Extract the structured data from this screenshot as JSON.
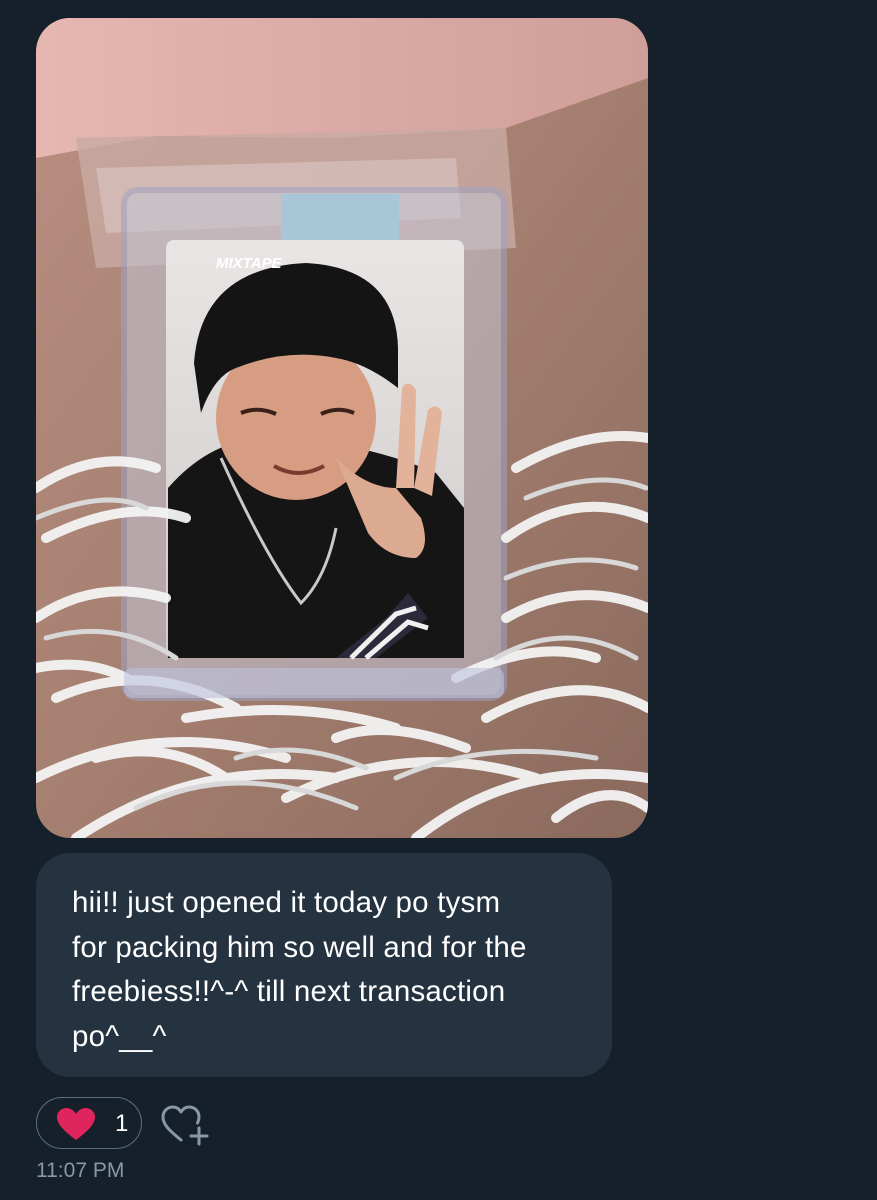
{
  "message": {
    "image_alt": "photo",
    "photo_brand_text": "MIXTAPE",
    "lines": [
      "hii!! just opened it today po tysm",
      "for packing him so well and for the",
      "freebiess!!^-^ till next transaction",
      "po^__^"
    ],
    "timestamp": "11:07 PM"
  },
  "reactions": {
    "heart_icon": "heart-icon",
    "count": "1",
    "add_icon": "add-reaction-icon"
  },
  "colors": {
    "background": "#15202b",
    "bubble": "#253341",
    "heart": "#e0245e",
    "muted_text": "#8899a6"
  }
}
